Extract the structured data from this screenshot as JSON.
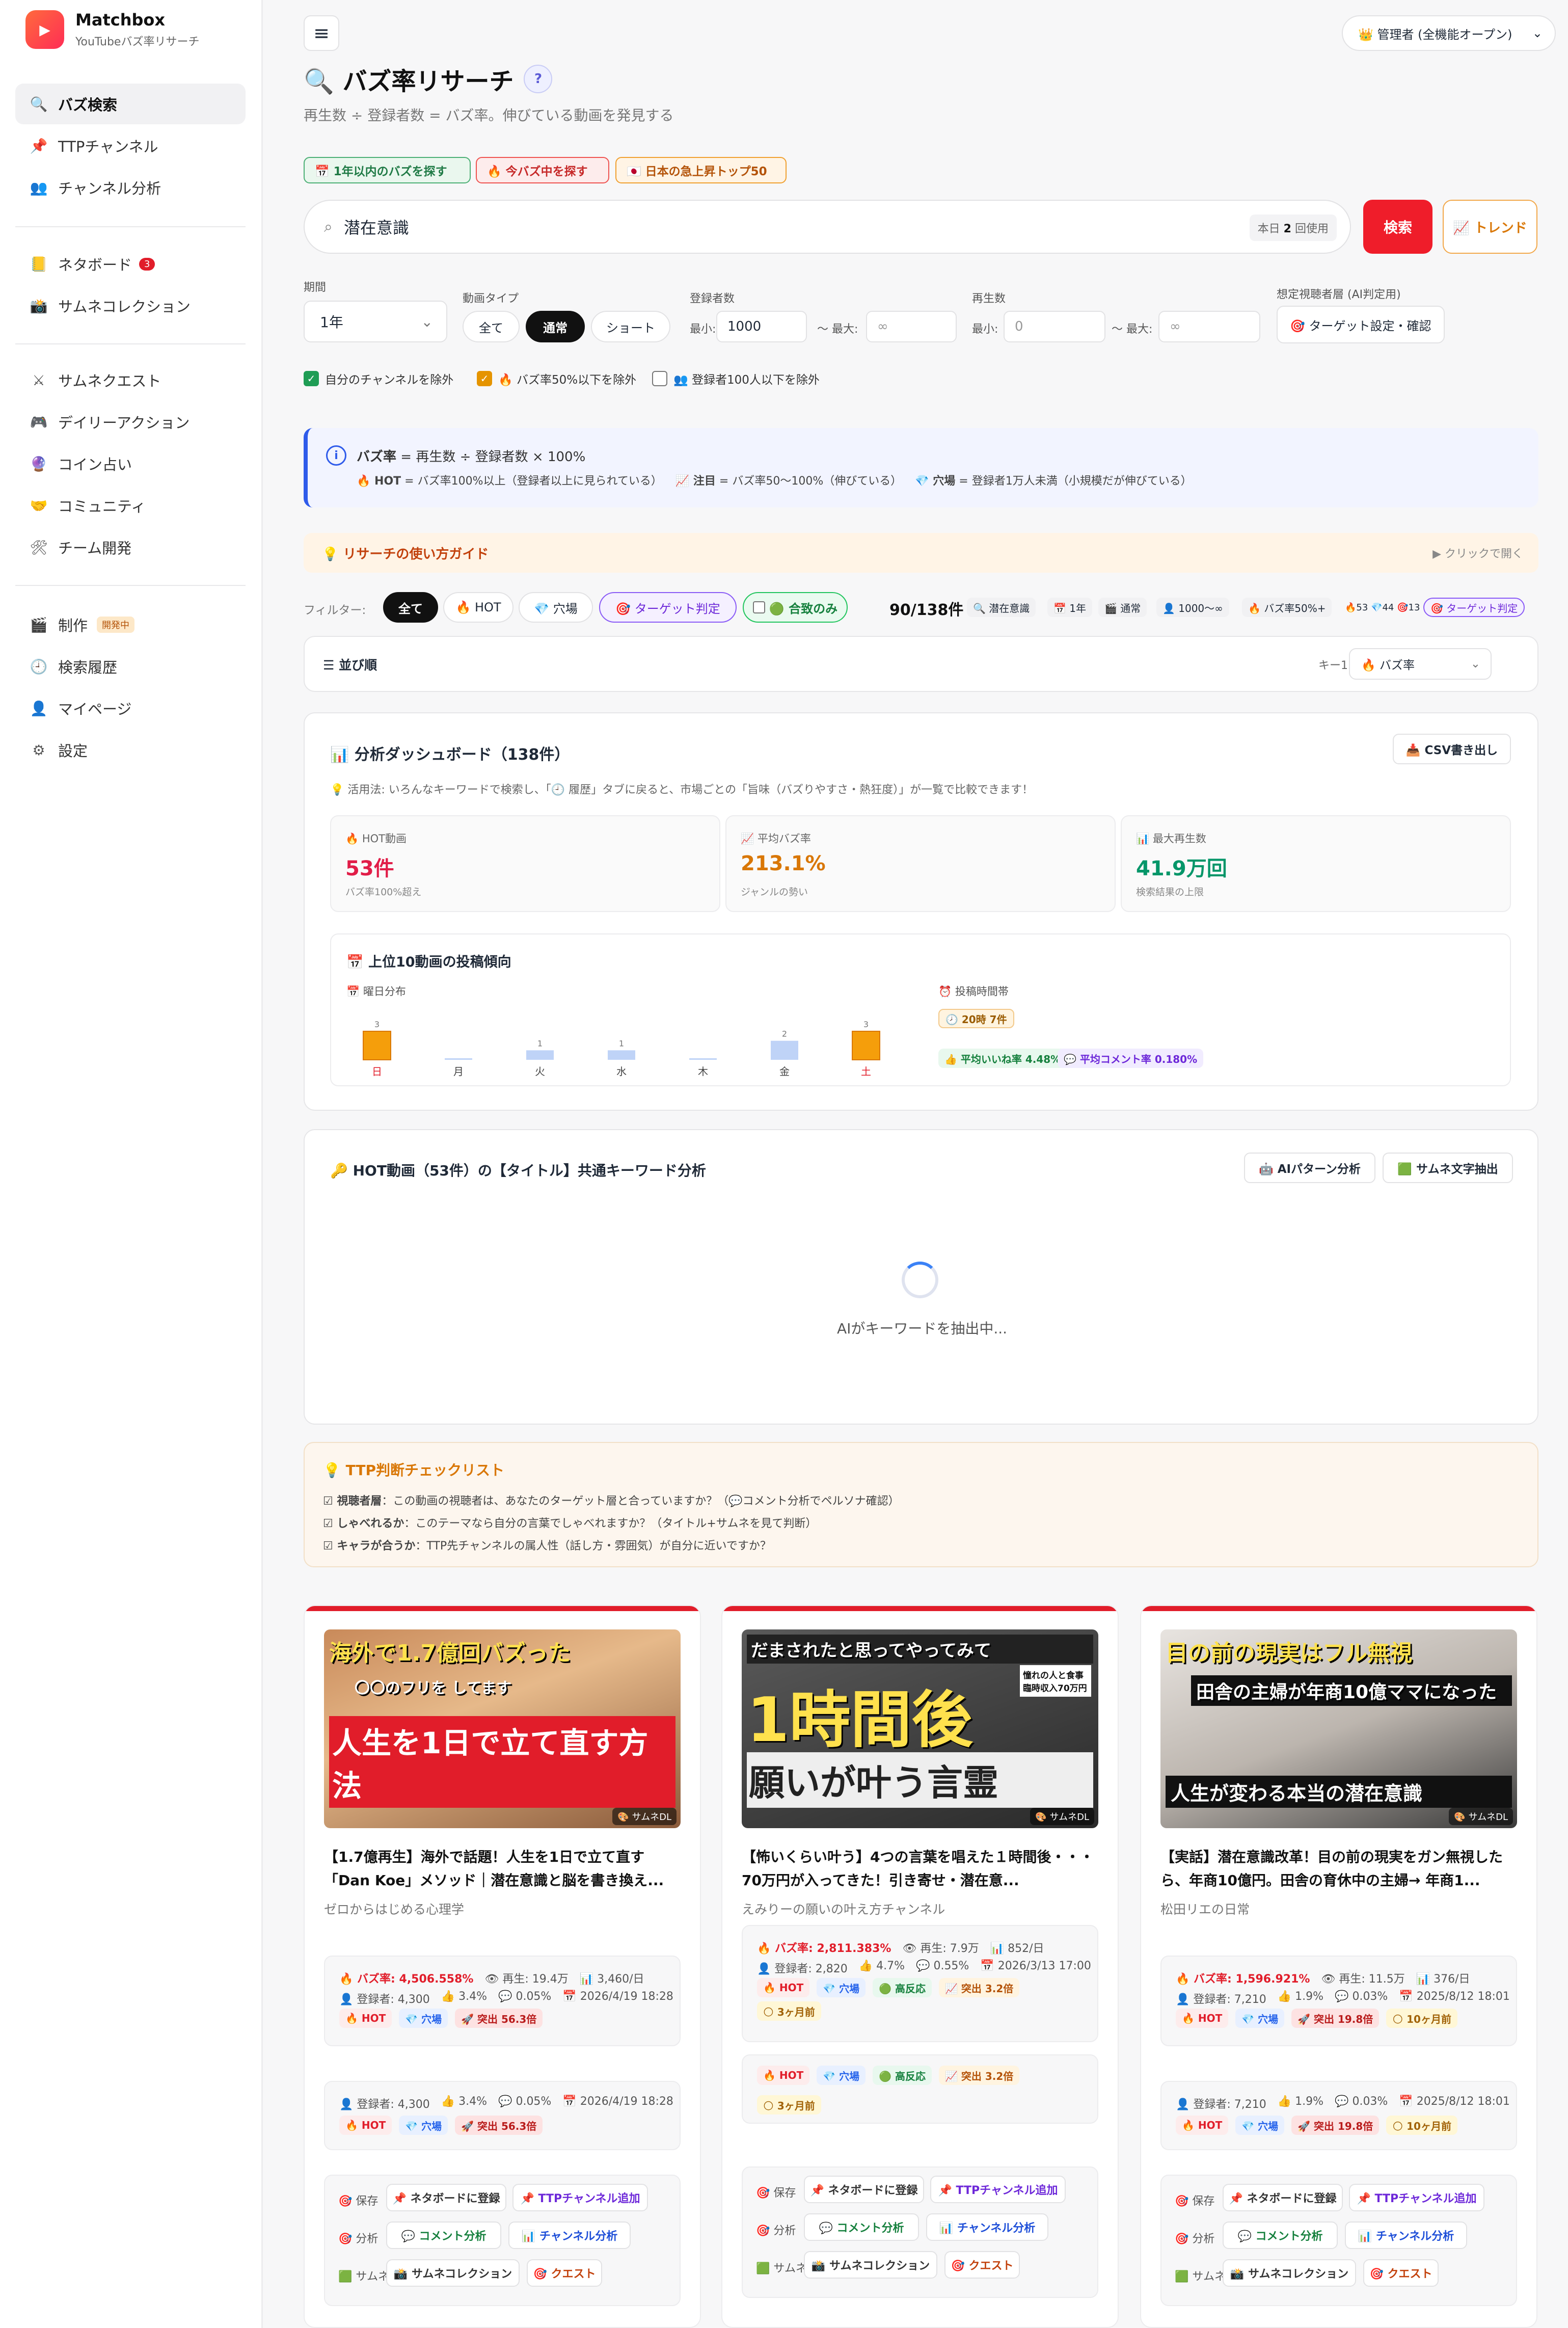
{
  "app": {
    "name": "Matchbox",
    "subtitle": "YouTubeバズ率リサーチ"
  },
  "sidebar": {
    "items": [
      {
        "icon": "search-icon",
        "glyph": "🔍",
        "label": "バズ検索"
      },
      {
        "icon": "pin-icon",
        "glyph": "📌",
        "label": "TTPチャンネル"
      },
      {
        "icon": "users-icon",
        "glyph": "👥",
        "label": "チャンネル分析"
      },
      {
        "icon": "notebook-icon",
        "glyph": "📒",
        "label": "ネタボード",
        "badge": "3"
      },
      {
        "icon": "camera-icon",
        "glyph": "📸",
        "label": "サムネコレクション"
      },
      {
        "icon": "swords-icon",
        "glyph": "⚔",
        "label": "サムネクエスト"
      },
      {
        "icon": "gamepad-icon",
        "glyph": "🎮",
        "label": "デイリーアクション"
      },
      {
        "icon": "coin-icon",
        "glyph": "🔮",
        "label": "コイン占い"
      },
      {
        "icon": "handshake-icon",
        "glyph": "🤝",
        "label": "コミュニティ"
      },
      {
        "icon": "tools-icon",
        "glyph": "🛠",
        "label": "チーム開発"
      },
      {
        "icon": "clapper-icon",
        "glyph": "🎬",
        "label": "制作",
        "dev_badge": "開発中"
      },
      {
        "icon": "history-icon",
        "glyph": "🕘",
        "label": "検索履歴"
      },
      {
        "icon": "person-icon",
        "glyph": "👤",
        "label": "マイページ"
      },
      {
        "icon": "gear-icon",
        "glyph": "⚙",
        "label": "設定"
      }
    ]
  },
  "header": {
    "admin_label": "👑 管理者 (全機能オープン)"
  },
  "page": {
    "title": "🔍 バズ率リサーチ",
    "help": "?",
    "subtitle": "再生数 ÷ 登録者数 = バズ率。伸びている動画を発見する",
    "quick": [
      "📅 1年以内のバズを探す",
      "🔥 今バズ中を探す",
      "🇯🇵 日本の急上昇トップ50"
    ]
  },
  "search": {
    "value": "潜在意識",
    "count_prefix": "本日",
    "count_num": "2",
    "count_suffix": "回使用",
    "button": "検索",
    "trend": "📈 トレンド"
  },
  "filters": {
    "period_label": "期間",
    "period_value": "1年",
    "type_label": "動画タイプ",
    "types": [
      "全て",
      "通常",
      "ショート"
    ],
    "subs_label": "登録者数",
    "min_label": "最小:",
    "max_label": "〜 最大:",
    "subs_min": "1000",
    "subs_max": "∞",
    "views_label": "再生数",
    "views_min": "0",
    "views_max": "∞",
    "target_label": "想定視聴者層 (AI判定用)",
    "target_btn": "🎯 ターゲット設定・確認"
  },
  "checks": [
    "自分のチャンネルを除外",
    "🔥 バズ率50%以下を除外",
    "👥 登録者100人以下を除外"
  ],
  "info": {
    "line1_bold": "バズ率",
    "line1": " = 再生数 ÷ 登録者数 × 100%",
    "hot_bold": "🔥 HOT",
    "hot": " = バズ率100%以上（登録者以上に見られている）",
    "watch_bold": "📈 注目",
    "watch": " = バズ率50〜100%（伸びている）",
    "hole_bold": "💎 穴場",
    "hole": " = 登録者1万人未満（小規模だが伸びている）"
  },
  "guide": {
    "title": "💡 リサーチの使い方ガイド",
    "hint": "▶ クリックで開く"
  },
  "filterbar": {
    "label": "フィルター:",
    "chips": [
      "全て",
      "🔥 HOT",
      "💎 穴場",
      "🎯 ターゲット判定",
      "🟢 合致のみ"
    ],
    "count": "90/138件",
    "tags": [
      "🔍 潜在意識",
      "📅 1年",
      "🎬 通常",
      "👤 1000〜∞",
      "🔥 バズ率50%+",
      "🔥53 💎44 🎯13",
      "🎯 ターゲット判定"
    ]
  },
  "sort": {
    "label": "並び順",
    "key_label": "キー1:",
    "key_value": "🔥 バズ率"
  },
  "dashboard": {
    "title": "📊 分析ダッシュボード（138件）",
    "csv": "📥 CSV書き出し",
    "tip": "💡 活用法: いろんなキーワードで検索し、「🕘 履歴」タブに戻ると、市場ごとの「旨味（バズりやすさ・熱狂度）」が一覧で比較できます！",
    "stats": [
      {
        "label": "🔥 HOT動画",
        "value": "53件",
        "sub": "バズ率100%超え",
        "color": "#e11d48"
      },
      {
        "label": "📈 平均バズ率",
        "value": "213.1%",
        "sub": "ジャンルの勢い",
        "color": "#d97706"
      },
      {
        "label": "📊 最大再生数",
        "value": "41.9万回",
        "sub": "検索結果の上限",
        "color": "#059669"
      }
    ],
    "trend_title": "📅 上位10動画の投稿傾向",
    "weekday_title": "📅 曜日分布",
    "weekdays": [
      {
        "day": "日",
        "count": 3
      },
      {
        "day": "月",
        "count": 0
      },
      {
        "day": "火",
        "count": 1
      },
      {
        "day": "水",
        "count": 1
      },
      {
        "day": "木",
        "count": 0
      },
      {
        "day": "金",
        "count": 2
      },
      {
        "day": "土",
        "count": 3
      }
    ],
    "time_title": "⏰ 投稿時間帯",
    "time_value": "🕗 20時 7件",
    "avg_like": "👍 平均いいね率 4.48%",
    "avg_comment": "💬 平均コメント率 0.180%"
  },
  "keyword": {
    "title": "🔑 HOT動画（53件）の【タイトル】共通キーワード分析",
    "ai_btn": "🤖 AIパターン分析",
    "thumb_btn": "🟩 サムネ文字抽出",
    "loading": "AIがキーワードを抽出中..."
  },
  "checklist": {
    "title": "💡 TTP判断チェックリスト",
    "items": [
      {
        "bold": "☑ 視聴者層",
        "text": "：この動画の視聴者は、あなたのターゲット層と合っていますか？（💬コメント分析でペルソナ確認）"
      },
      {
        "bold": "☑ しゃべれるか",
        "text": "：このテーマなら自分の言葉でしゃべれますか？（タイトル+サムネを見て判断）"
      },
      {
        "bold": "☑ キャラが合うか",
        "text": "：TTP先チャンネルの属人性（話し方・雰囲気）が自分に近いですか？"
      }
    ]
  },
  "videos": [
    {
      "thumb_top": "海外で1.7億回バズった",
      "thumb_mid": "〇〇のフリを してます",
      "thumb_bottom": "人生を1日で立て直す方法",
      "thumb_tag": "🎨 サムネDL",
      "title": "【1.7億再生】海外で話題！人生を1日で立て直す「Dan Koe」メソッド｜潜在意識と脳を書き換え...",
      "channel": "ゼロからはじめる心理学",
      "buzz": "🔥 バズ率: 4,506.558%",
      "views": "👁 再生: 19.4万",
      "daily": "📊 3,460/日",
      "subs": "👤 登録者: 4,300",
      "like": "👍 3.4%",
      "comment": "💬 0.05%",
      "date": "📅 2026/4/19 18:28",
      "pills": [
        "🔥 HOT",
        "💎 穴場",
        "🚀 突出 56.3倍"
      ],
      "extra": []
    },
    {
      "thumb_top": "だまされたと思ってやってみて",
      "thumb_mid": "1時間後",
      "thumb_bottom": "願いが叶う言霊",
      "thumb_side": "憧れの人と食事 臨時収入70万円",
      "thumb_tag": "🎨 サムネDL",
      "title": "【怖いくらい叶う】4つの言葉を唱えた１時間後・・・70万円が入ってきた！引き寄せ・潜在意...",
      "channel": "えみりーの願いの叶え方チャンネル",
      "buzz": "🔥 バズ率: 2,811.383%",
      "views": "👁 再生: 7.9万",
      "daily": "📊 852/日",
      "subs": "👤 登録者: 2,820",
      "like": "👍 4.7%",
      "comment": "💬 0.55%",
      "date": "📅 2026/3/13 17:00",
      "pills": [
        "🔥 HOT",
        "💎 穴場",
        "🟢 高反応",
        "📈 突出 3.2倍"
      ],
      "extra": [
        "🌕 3ヶ月前"
      ]
    },
    {
      "thumb_top": "目の前の現実はフル無視",
      "thumb_mid": "田舎の主婦が年商10億ママになった",
      "thumb_bottom": "人生が変わる本当の潜在意識",
      "thumb_tag": "🎨 サムネDL",
      "title": "【実話】潜在意識改革！目の前の現実をガン無視したら、年商10億円。田舎の育休中の主婦→ 年商1...",
      "channel": "松田リエの日常",
      "buzz": "🔥 バズ率: 1,596.921%",
      "views": "👁 再生: 11.5万",
      "daily": "📊 376/日",
      "subs": "👤 登録者: 7,210",
      "like": "👍 1.9%",
      "comment": "💬 0.03%",
      "date": "📅 2025/8/12 18:01",
      "pills": [
        "🔥 HOT",
        "💎 穴場",
        "🚀 突出 19.8倍",
        "🌕 10ヶ月前"
      ],
      "extra": []
    }
  ],
  "actions": {
    "save_label": "🎯 保存",
    "analyze_label": "🎯 分析",
    "thumb_label": "🟩 サムネ",
    "save_btns": [
      "📌 ネタボードに登録",
      "📌 TTPチャンネル追加"
    ],
    "analyze_btns": [
      "💬 コメント分析",
      "📊 チャンネル分析"
    ],
    "thumb_btns": [
      "📸 サムネコレクション",
      "🎯 クエスト"
    ]
  }
}
